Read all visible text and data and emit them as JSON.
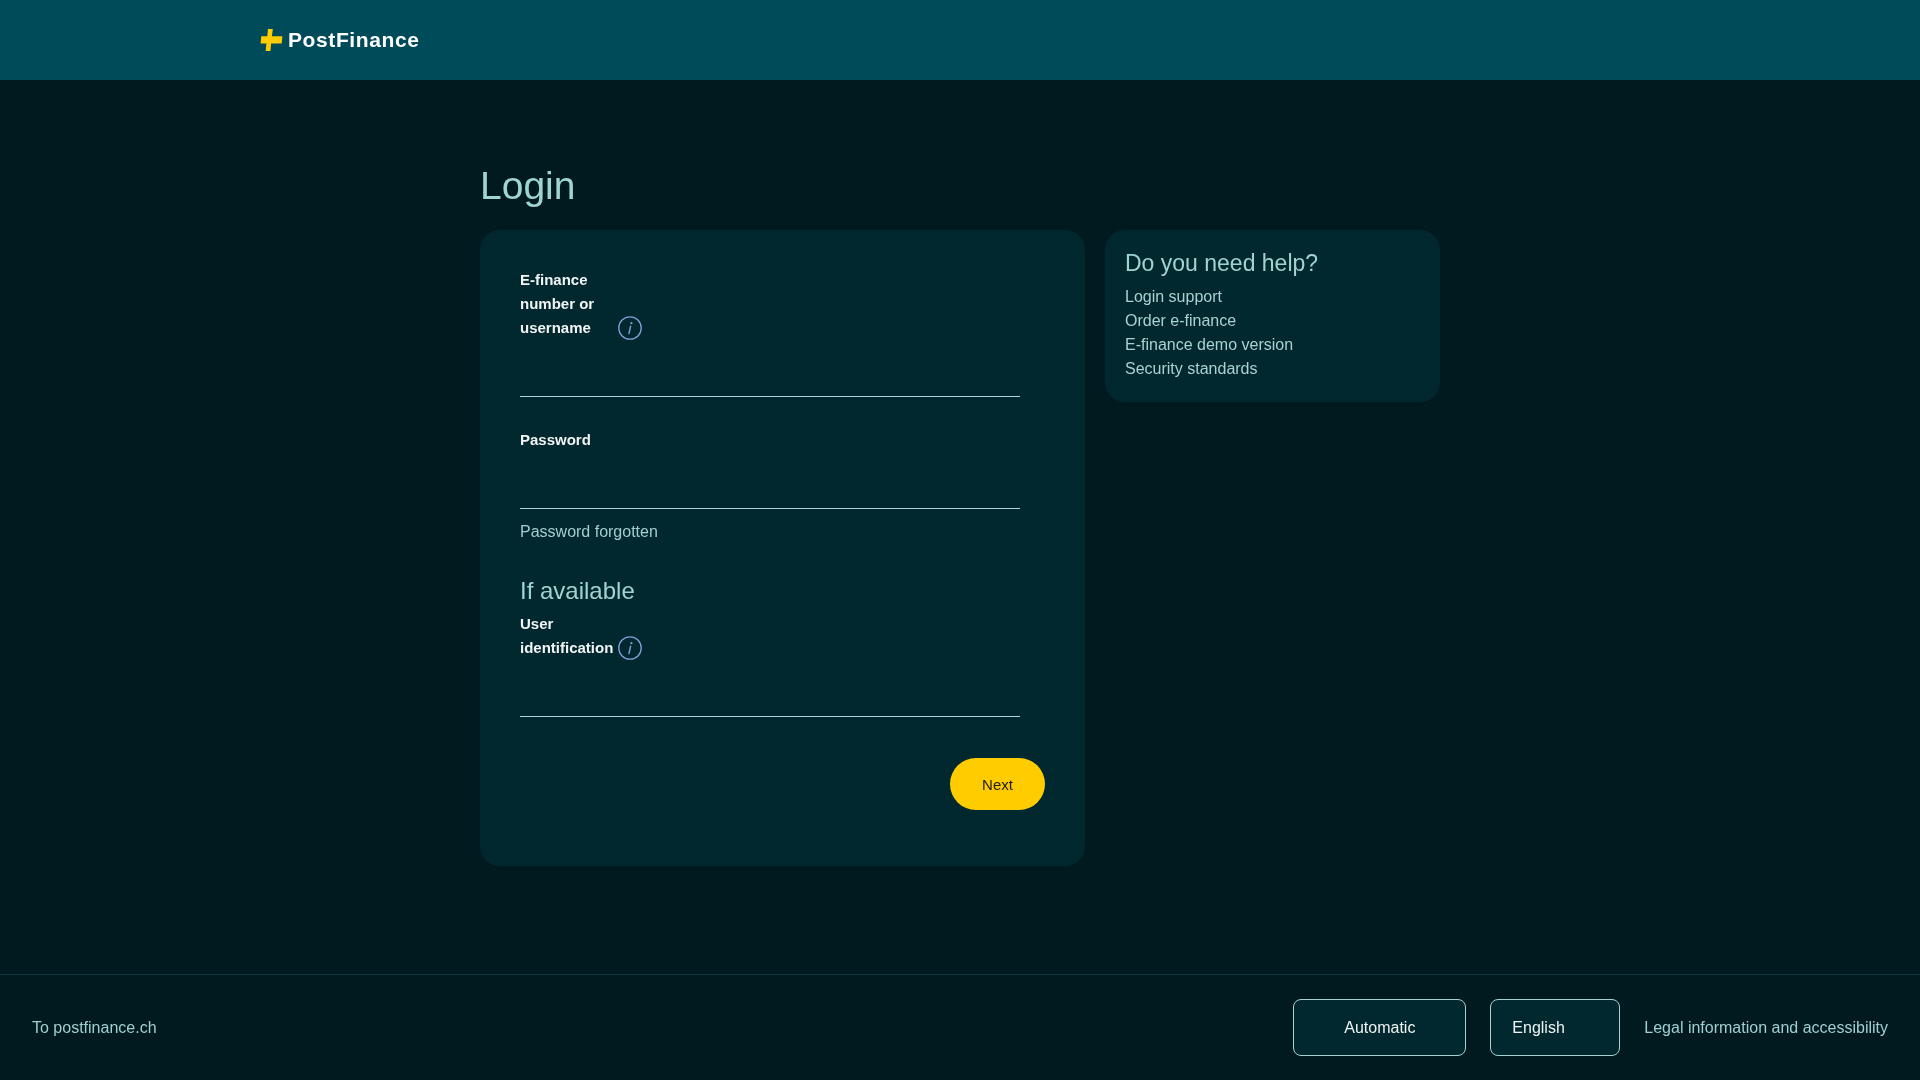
{
  "header": {
    "logo_text": "PostFinance"
  },
  "page_title": "Login",
  "login_form": {
    "fields": [
      {
        "label": "E-finance number or username",
        "info": true
      },
      {
        "label": "Password",
        "info": false,
        "link": "Password forgotten"
      }
    ],
    "optional_section": {
      "heading": "If available",
      "fields": [
        {
          "label": "User identification",
          "info": true
        }
      ]
    },
    "submit_button": "Next"
  },
  "help": {
    "title": "Do you need help?",
    "links": [
      "Login support",
      "Order e-finance",
      "E-finance demo version",
      "Security standards"
    ]
  },
  "footer": {
    "home_link": "To postfinance.ch",
    "theme_select": "Automatic",
    "language_select": "English",
    "legal_link": "Legal information and accessibility"
  }
}
